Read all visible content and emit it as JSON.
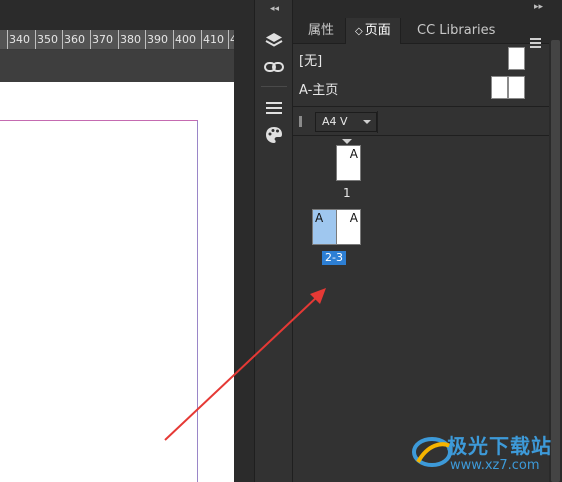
{
  "ruler": {
    "labels": [
      "340",
      "350",
      "360",
      "370",
      "380",
      "390",
      "400",
      "410",
      "4"
    ]
  },
  "panel": {
    "tabs": [
      "属性",
      "页面",
      "CC Libraries"
    ],
    "active_tab_prefix": "◇",
    "masters": [
      {
        "label": "[无]"
      },
      {
        "label": "A-主页"
      }
    ],
    "page_size": "A4 V",
    "pages": [
      {
        "letter": "A",
        "number": "1"
      },
      {
        "left_letter": "A",
        "right_letter": "A",
        "number": "2-3"
      }
    ]
  },
  "iconbar": {
    "icons": [
      "layers-icon",
      "links-icon",
      "stroke-icon",
      "swatches-icon"
    ]
  },
  "watermark": {
    "text": "极光下载站",
    "url": "www.xz7.com"
  },
  "colors": {
    "accent": "#2d7fd4",
    "annotation_arrow": "#e53935",
    "margin_guide": "#c56bb1"
  }
}
